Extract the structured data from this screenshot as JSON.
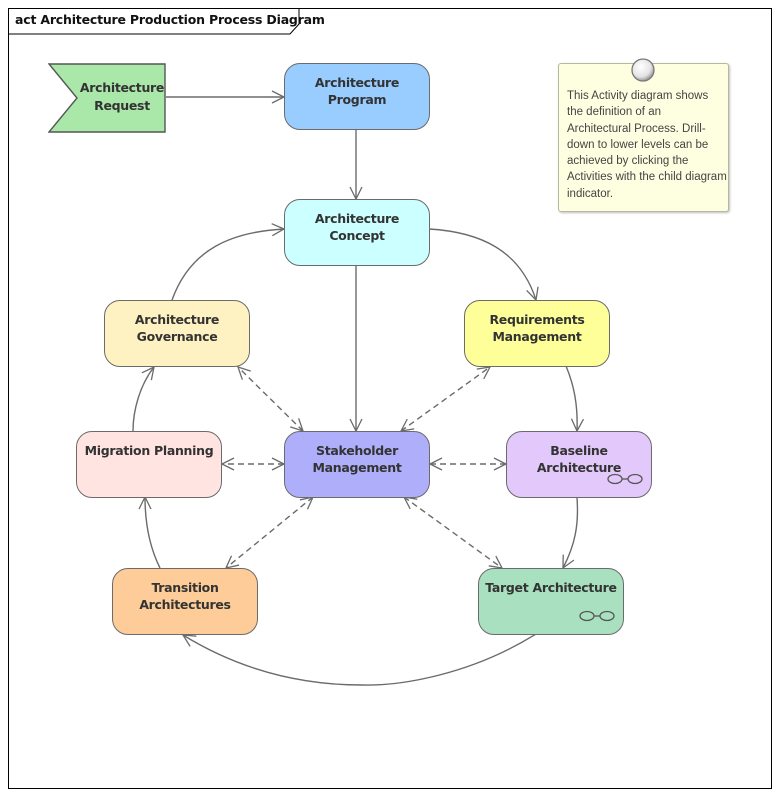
{
  "diagram": {
    "title": "act Architecture Production Process Diagram",
    "note": {
      "text": "This Activity diagram shows the definition of an Architectural Process. Drill-down to lower levels can be achieved by clicking the Activities with the child diagram indicator."
    },
    "accept_event": {
      "line1": "Architecture",
      "line2": "Request",
      "color": "#aae8aa"
    },
    "activities": [
      {
        "id": "architecture-program",
        "line1": "Architecture Program",
        "line2": "",
        "color": "#99ccff",
        "has_child_diagram": false
      },
      {
        "id": "architecture-concept",
        "line1": "Architecture Concept",
        "line2": "",
        "color": "#ccffff",
        "has_child_diagram": false
      },
      {
        "id": "architecture-governance",
        "line1": "Architecture",
        "line2": "Governance",
        "color": "#fff2c2",
        "has_child_diagram": false
      },
      {
        "id": "requirements-management",
        "line1": "Requirements",
        "line2": "Management",
        "color": "#ffff99",
        "has_child_diagram": false
      },
      {
        "id": "migration-planning",
        "line1": "Migration Planning",
        "line2": "",
        "color": "#ffe4e1",
        "has_child_diagram": false
      },
      {
        "id": "stakeholder-management",
        "line1": "Stakeholder",
        "line2": "Management",
        "color": "#aeaefa",
        "has_child_diagram": false
      },
      {
        "id": "baseline-architecture",
        "line1": "Baseline Architecture",
        "line2": "",
        "color": "#e3c9fb",
        "has_child_diagram": true
      },
      {
        "id": "transition-architectures",
        "line1": "Transition",
        "line2": "Architectures",
        "color": "#fdcc99",
        "has_child_diagram": false
      },
      {
        "id": "target-architecture",
        "line1": "Target Architecture",
        "line2": "",
        "color": "#a8e0c0",
        "has_child_diagram": true
      }
    ],
    "flows": [
      {
        "from": "architecture-request",
        "to": "architecture-program",
        "style": "solid"
      },
      {
        "from": "architecture-program",
        "to": "architecture-concept",
        "style": "solid"
      },
      {
        "from": "architecture-concept",
        "to": "requirements-management",
        "style": "solid"
      },
      {
        "from": "architecture-concept",
        "to": "stakeholder-management",
        "style": "solid"
      },
      {
        "from": "architecture-governance",
        "to": "architecture-concept",
        "style": "solid"
      },
      {
        "from": "requirements-management",
        "to": "baseline-architecture",
        "style": "solid"
      },
      {
        "from": "baseline-architecture",
        "to": "target-architecture",
        "style": "solid"
      },
      {
        "from": "target-architecture",
        "to": "transition-architectures",
        "style": "solid"
      },
      {
        "from": "transition-architectures",
        "to": "migration-planning",
        "style": "solid"
      },
      {
        "from": "migration-planning",
        "to": "architecture-governance",
        "style": "solid"
      },
      {
        "from": "stakeholder-management",
        "to": "architecture-governance",
        "style": "dashed-bidirectional"
      },
      {
        "from": "stakeholder-management",
        "to": "requirements-management",
        "style": "dashed-bidirectional"
      },
      {
        "from": "stakeholder-management",
        "to": "migration-planning",
        "style": "dashed-bidirectional"
      },
      {
        "from": "stakeholder-management",
        "to": "baseline-architecture",
        "style": "dashed-bidirectional"
      },
      {
        "from": "stakeholder-management",
        "to": "transition-architectures",
        "style": "dashed-bidirectional"
      },
      {
        "from": "stakeholder-management",
        "to": "target-architecture",
        "style": "dashed-bidirectional"
      }
    ],
    "colors": {
      "connector": "#6b6b6b",
      "node_border": "#6b6b6b",
      "note_fill": "#fefee0"
    }
  }
}
